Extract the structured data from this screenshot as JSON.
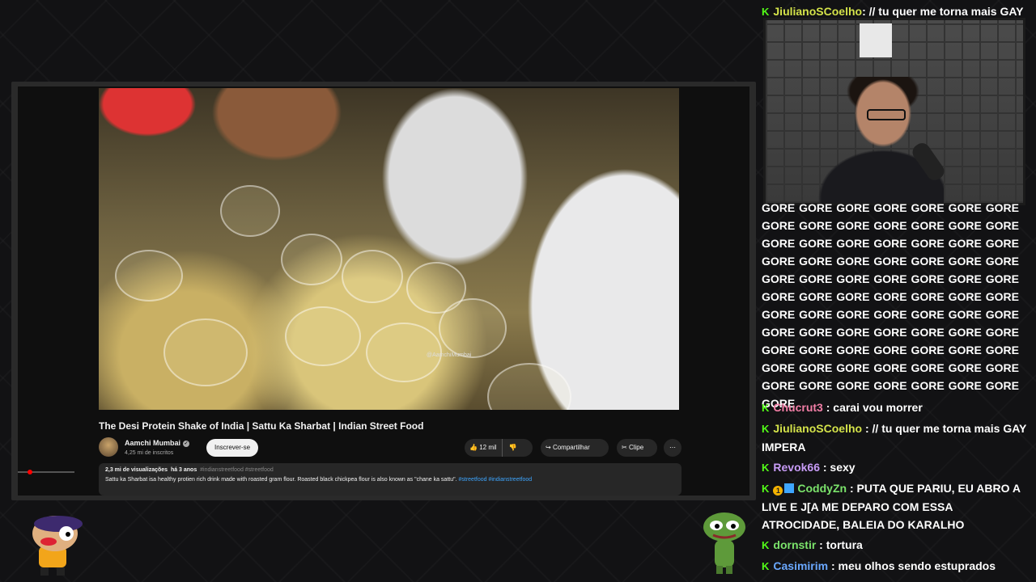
{
  "video": {
    "title": "The Desi Protein Shake of India | Sattu Ka Sharbat | Indian Street Food",
    "watermark": "@AamchiMumbai",
    "channel_name": "Aamchi Mumbai",
    "subscribers": "4,25 mi de inscritos",
    "subscribe_label": "Inscrever-se",
    "likes": "12 mil",
    "share_label": "Compartilhar",
    "clip_label": "Clipe",
    "more_label": "⋯",
    "description": {
      "views": "2,3 mi de visualizações",
      "date": "há 3 anos",
      "tags": "#indianstreetfood #streetfood",
      "text": "Sattu ka Sharbat isa healthy protien rich drink made with roasted gram flour. Roasted black chickpea flour is also known as \"chane ka sattu\".",
      "text_tags": "#streetfood #indianstreetfood"
    }
  },
  "chat": {
    "top_message": {
      "user": "JiulianoSCoelho",
      "user_color": "#d4e34a",
      "text": ": // tu quer me torna mais GAY"
    },
    "spam_text": "GORE GORE GORE GORE GORE GORE GORE GORE GORE GORE GORE GORE GORE GORE GORE GORE GORE GORE GORE GORE GORE GORE GORE GORE GORE GORE GORE GORE GORE GORE GORE GORE GORE GORE GORE GORE GORE GORE GORE GORE GORE GORE GORE GORE GORE GORE GORE GORE GORE GORE GORE GORE GORE GORE GORE GORE GORE GORE GORE GORE GORE GORE GORE GORE GORE GORE GORE GORE GORE GORE GORE GORE GORE GORE GORE GORE GORE GORE",
    "messages": [
      {
        "user": "Chucrut3",
        "user_color": "#f27ea6",
        "text": ": carai vou morrer"
      },
      {
        "user": "JiulianoSCoelho",
        "user_color": "#d4e34a",
        "text": ": // tu quer me torna mais GAY IMPERA"
      },
      {
        "user": "Revok66",
        "user_color": "#c89cf7",
        "text": ": sexy"
      },
      {
        "user": "CoddyZn",
        "user_color": "#7be36b",
        "text": ": PUTA QUE PARIU, EU ABRO A LIVE E J[A ME DEPARO COM ESSA ATROCIDADE, BALEIA DO KARALHO",
        "badge": "1"
      },
      {
        "user": "dornstir",
        "user_color": "#7be36b",
        "text": ": tortura"
      },
      {
        "user": "Casimirim",
        "user_color": "#6aa8ff",
        "text": ": meu olhos sendo estuprados"
      }
    ],
    "kick_glyph": "K"
  },
  "colors": {
    "kick_green": "#53fc18",
    "yt_bg": "#0f0f0f",
    "link_blue": "#3ea6ff"
  }
}
